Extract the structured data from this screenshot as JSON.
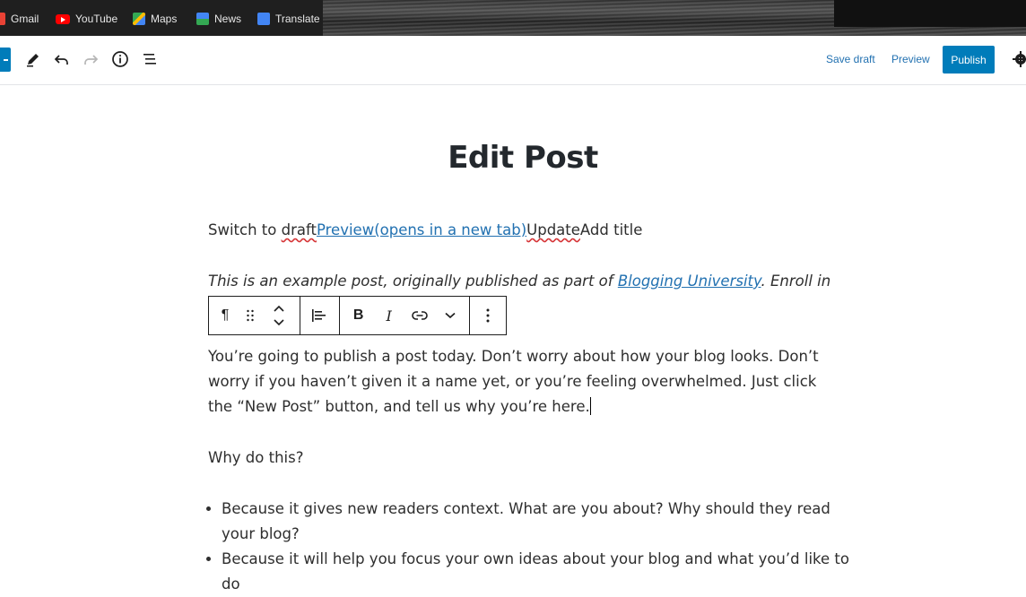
{
  "bookmarks": [
    {
      "label": "Gmail"
    },
    {
      "label": "YouTube"
    },
    {
      "label": "Maps"
    },
    {
      "label": "News"
    },
    {
      "label": "Translate"
    }
  ],
  "toolbar": {
    "save_draft": "Save draft",
    "preview": "Preview",
    "publish": "Publish"
  },
  "editor": {
    "title": "Edit Post",
    "switch_line": {
      "prefix": "Switch to ",
      "draft": "draft",
      "preview_link": "Preview(opens in a new tab)",
      "update": "Update",
      "add": "Add",
      "suffix": " title"
    },
    "example": {
      "before": "This is an example post, originally published as part of ",
      "link": "Blogging University",
      "after": ". Enroll in one of our"
    },
    "paragraph": "You’re going to publish a post today. Don’t worry about how your blog looks. Don’t worry if you haven’t given it a name yet, or you’re feeling overwhelmed. Just click the “New Post” button, and tell us why you’re here.",
    "why": "Why do this?",
    "list_items": [
      "Because it gives new readers context. What are you about? Why should they read your blog?",
      "Because it will help you focus your own ideas about your blog and what you’d like to do"
    ]
  },
  "block_toolbar": {
    "paragraph_icon": "¶",
    "bold": "B",
    "italic": "I"
  },
  "colors": {
    "accent": "#007cba",
    "link": "#2271b1"
  }
}
